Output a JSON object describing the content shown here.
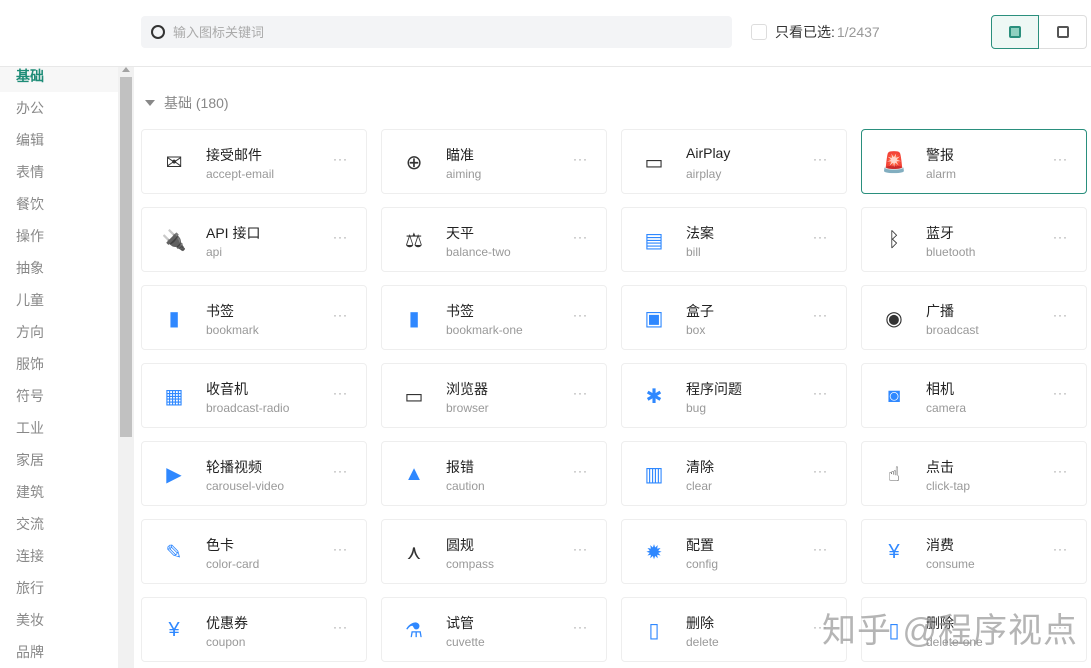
{
  "search": {
    "placeholder": "输入图标关键词"
  },
  "filter": {
    "label": "只看已选:",
    "count": "1/2437"
  },
  "sidebar": [
    "基础",
    "办公",
    "编辑",
    "表情",
    "餐饮",
    "操作",
    "抽象",
    "儿童",
    "方向",
    "服饰",
    "符号",
    "工业",
    "家居",
    "建筑",
    "交流",
    "连接",
    "旅行",
    "美妆",
    "品牌"
  ],
  "section": {
    "title": "基础 (180)"
  },
  "more_label": "···",
  "icons": [
    {
      "name": "接受邮件",
      "id": "accept-email",
      "glyph": "✉"
    },
    {
      "name": "瞄准",
      "id": "aiming",
      "glyph": "⊕"
    },
    {
      "name": "AirPlay",
      "id": "airplay",
      "glyph": "▭"
    },
    {
      "name": "警报",
      "id": "alarm",
      "glyph": "🚨"
    },
    {
      "name": "API 接口",
      "id": "api",
      "glyph": "🔌"
    },
    {
      "name": "天平",
      "id": "balance-two",
      "glyph": "⚖"
    },
    {
      "name": "法案",
      "id": "bill",
      "glyph": "▤"
    },
    {
      "name": "蓝牙",
      "id": "bluetooth",
      "glyph": "ᛒ"
    },
    {
      "name": "书签",
      "id": "bookmark",
      "glyph": "▮"
    },
    {
      "name": "书签",
      "id": "bookmark-one",
      "glyph": "▮"
    },
    {
      "name": "盒子",
      "id": "box",
      "glyph": "▣"
    },
    {
      "name": "广播",
      "id": "broadcast",
      "glyph": "◉"
    },
    {
      "name": "收音机",
      "id": "broadcast-radio",
      "glyph": "▦"
    },
    {
      "name": "浏览器",
      "id": "browser",
      "glyph": "▭"
    },
    {
      "name": "程序问题",
      "id": "bug",
      "glyph": "✱"
    },
    {
      "name": "相机",
      "id": "camera",
      "glyph": "◙"
    },
    {
      "name": "轮播视频",
      "id": "carousel-video",
      "glyph": "▶"
    },
    {
      "name": "报错",
      "id": "caution",
      "glyph": "▲"
    },
    {
      "name": "清除",
      "id": "clear",
      "glyph": "▥"
    },
    {
      "name": "点击",
      "id": "click-tap",
      "glyph": "☝"
    },
    {
      "name": "色卡",
      "id": "color-card",
      "glyph": "✎"
    },
    {
      "name": "圆规",
      "id": "compass",
      "glyph": "⋏"
    },
    {
      "name": "配置",
      "id": "config",
      "glyph": "✹"
    },
    {
      "name": "消费",
      "id": "consume",
      "glyph": "¥"
    },
    {
      "name": "优惠券",
      "id": "coupon",
      "glyph": "¥"
    },
    {
      "name": "试管",
      "id": "cuvette",
      "glyph": "⚗"
    },
    {
      "name": "删除",
      "id": "delete",
      "glyph": "▯"
    },
    {
      "name": "删除",
      "id": "delete-one",
      "glyph": "▯"
    }
  ],
  "selected_index": 3,
  "colors": {
    "accent": "#2a8f7d",
    "icon_blue": "#2f88ff"
  },
  "watermark": "知乎 @程序视点"
}
